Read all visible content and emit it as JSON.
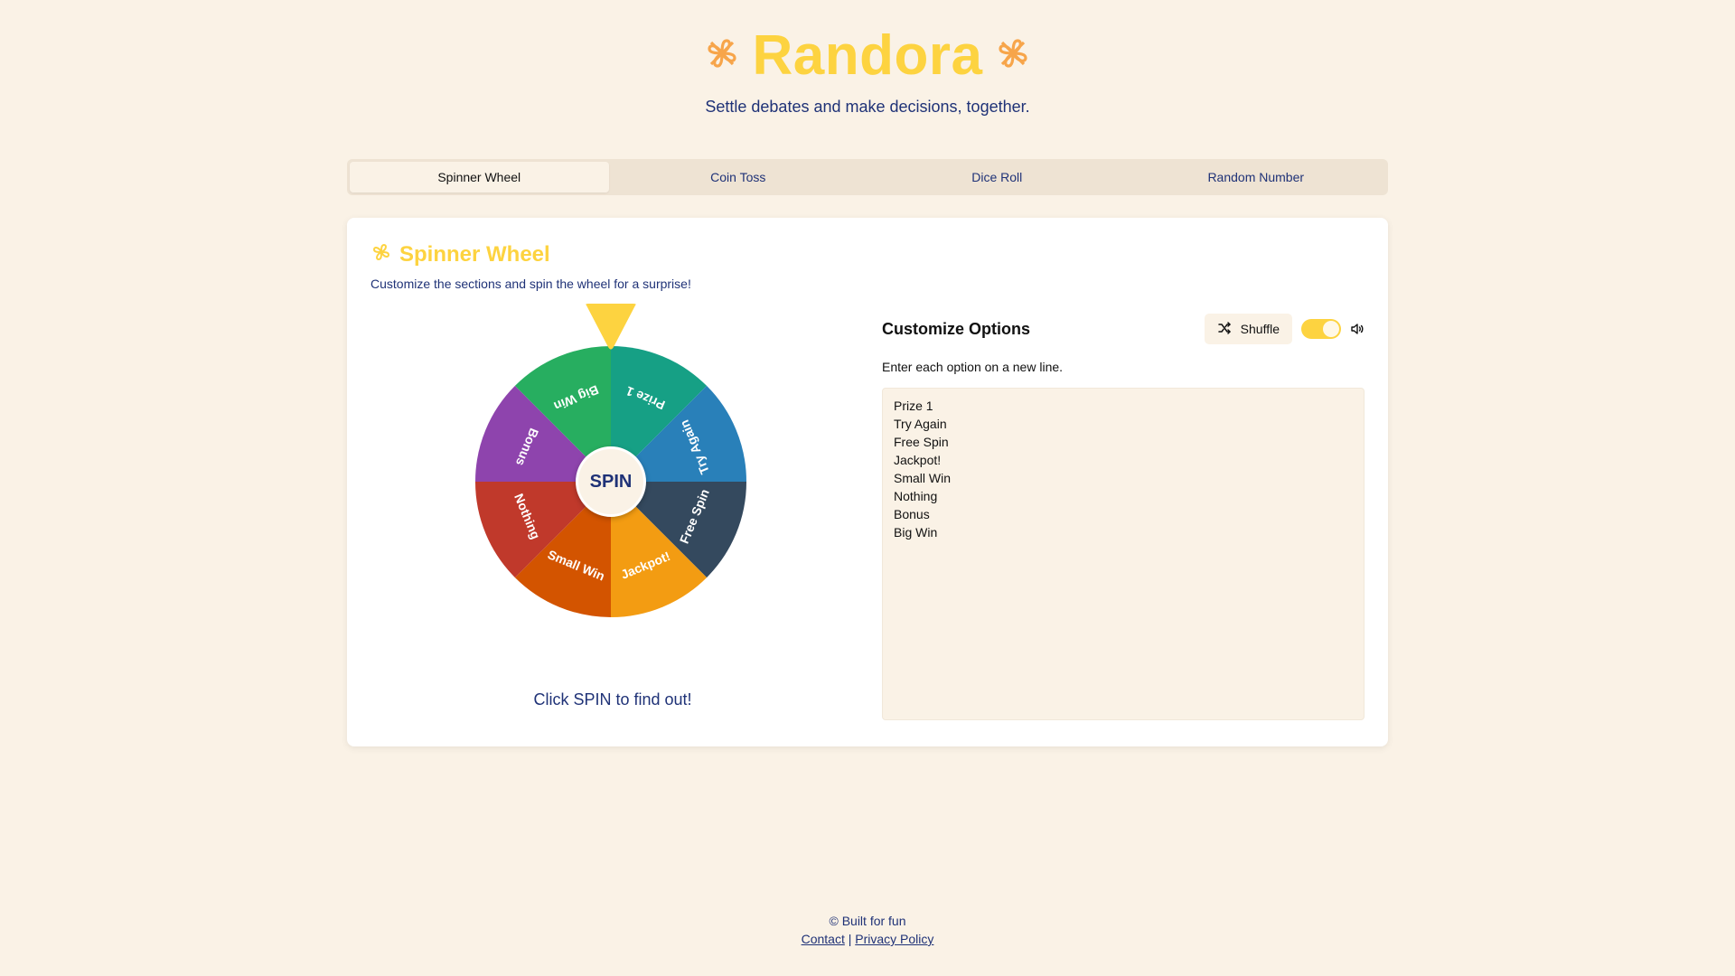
{
  "header": {
    "title": "Randora",
    "subtitle": "Settle debates and make decisions, together.",
    "clover_color": "#f7a54a",
    "title_color": "#fdd340"
  },
  "tabs": [
    {
      "label": "Spinner Wheel",
      "active": true
    },
    {
      "label": "Coin Toss",
      "active": false
    },
    {
      "label": "Dice Roll",
      "active": false
    },
    {
      "label": "Random Number",
      "active": false
    }
  ],
  "card": {
    "title": "Spinner Wheel",
    "description": "Customize the sections and spin the wheel for a surprise!",
    "icon": "clover-icon"
  },
  "wheel": {
    "segments": [
      {
        "label": "Prize 1",
        "color": "#16a085"
      },
      {
        "label": "Try Again",
        "color": "#2980b9"
      },
      {
        "label": "Free Spin",
        "color": "#34495e"
      },
      {
        "label": "Jackpot!",
        "color": "#f39c12"
      },
      {
        "label": "Small Win",
        "color": "#d35400"
      },
      {
        "label": "Nothing",
        "color": "#c0392b"
      },
      {
        "label": "Bonus",
        "color": "#8e44ad"
      },
      {
        "label": "Big Win",
        "color": "#27ae60"
      }
    ],
    "pointer_color": "#fdd340",
    "spin_label": "SPIN",
    "result_text": "Click SPIN to find out!"
  },
  "options": {
    "title": "Customize Options",
    "shuffle_label": "Shuffle",
    "sound_enabled": true,
    "hint": "Enter each option on a new line.",
    "lines": [
      "Prize 1",
      "Try Again",
      "Free Spin",
      "Jackpot!",
      "Small Win",
      "Nothing",
      "Bonus",
      "Big Win"
    ]
  },
  "footer": {
    "copyright": "© Built for fun",
    "contact_label": "Contact",
    "separator": "|",
    "privacy_label": "Privacy Policy"
  }
}
